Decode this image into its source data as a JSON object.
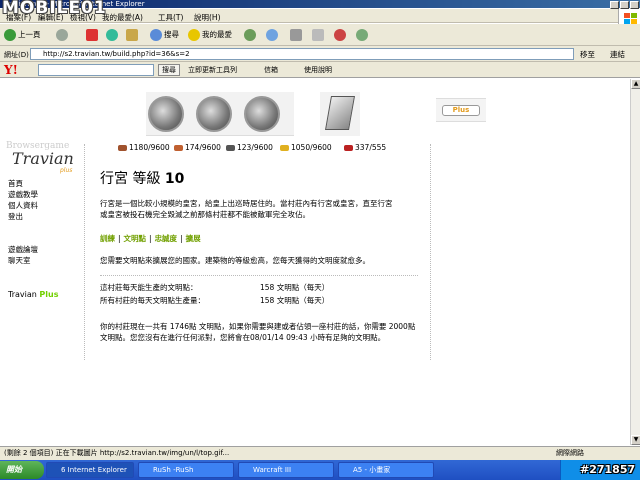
{
  "window": {
    "title": "Travian tw2 - Microsoft Internet Explorer",
    "watermark_logo": "MOBILE01"
  },
  "menu": [
    "檔案(F)",
    "編輯(E)",
    "檢視(V)",
    "我的最愛(A)",
    "工具(T)",
    "說明(H)"
  ],
  "toolbar": {
    "back": "上一頁",
    "search": "搜尋",
    "favorites": "我的最愛"
  },
  "address": {
    "label": "網址(D)",
    "url": "http://s2.travian.tw/build.php?id=36&s=2",
    "go": "移至",
    "links": "連結"
  },
  "yahoo": {
    "search_btn": "搜尋",
    "update_toolbar": "立即更新工具列",
    "mail": "信箱",
    "help": "使用說明"
  },
  "left_logo": {
    "ghost": "Browsergame",
    "main": "Travian",
    "plus": "plus"
  },
  "left_menu": [
    "首頁",
    "遊戲教學",
    "個人資料",
    "登出"
  ],
  "left_menu2": [
    "遊戲論壇",
    "聊天室"
  ],
  "travian_plus": {
    "a": "Travian",
    "b": "Plus"
  },
  "plus_button": "Plus",
  "resources": {
    "wood": "1180/9600",
    "clay": "174/9600",
    "iron": "123/9600",
    "crop": "1050/9600",
    "consumption": "337/555"
  },
  "page": {
    "title": "行宮 等級",
    "level": "10",
    "description": "行宮是一個比較小規模的皇宮，給皇上出巡時居住的。當村莊內有行宮或皇宮，直至行宮或皇宮被投石機完全毀滅之前那條村莊都不能被敵軍完全攻佔。",
    "tabs": [
      "訓練",
      "文明點",
      "忠誠度",
      "擴展"
    ],
    "intro": "您需要文明點來擴展您的國家。建築物的等級愈高，您每天獲得的文明度就愈多。",
    "stats": [
      {
        "label": "這村莊每天能生產的文明點：",
        "value": "158 文明點（每天）"
      },
      {
        "label": "所有村莊的每天文明點生產量：",
        "value": "158 文明點（每天）"
      }
    ],
    "footer": "你的村莊現在一共有 1746點 文明點，如果你需要與建或者佔領一座村莊的話，你需要 2000點 文明點。您您沒有在進行任何派對，您將會在08/01/14 09:43 小時有足夠的文明點。"
  },
  "status": {
    "text": "(剩餘 2 個項目) 正在下載圖片 http://s2.travian.tw/img/un/l/top.gif...",
    "zone": "網際網路"
  },
  "taskbar": {
    "start": "開始",
    "tasks": [
      "6 Internet Explorer",
      "RuSh -RuSh",
      "Warcraft III",
      "A5 - 小畫家"
    ],
    "watermark": "#271857"
  },
  "colors": {
    "tab_green": "#71a000",
    "plus_orange": "#e39b1c"
  }
}
